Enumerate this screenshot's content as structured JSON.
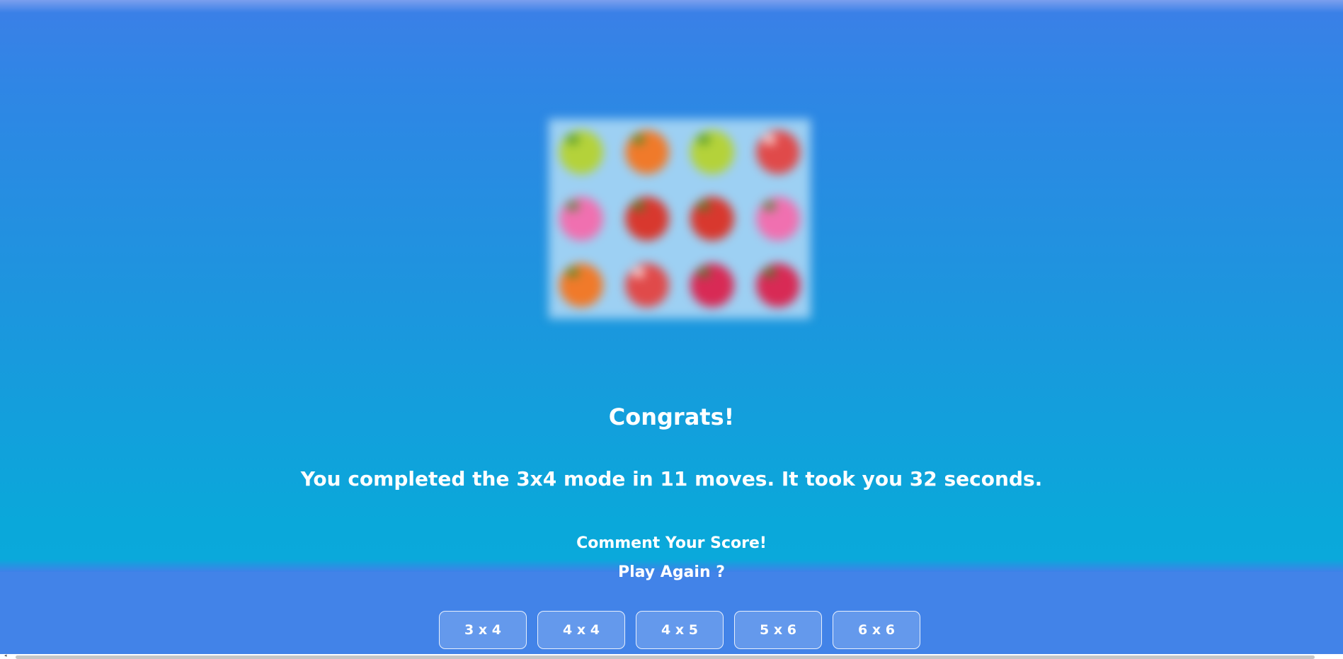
{
  "board": {
    "rows": 3,
    "cols": 4,
    "cards": [
      {
        "fruit": "pear",
        "color": "#b4d23a",
        "pale": false
      },
      {
        "fruit": "orange",
        "color": "#f07a2a",
        "pale": false
      },
      {
        "fruit": "pear",
        "color": "#b4d23a",
        "pale": false
      },
      {
        "fruit": "lychee",
        "color": "#e04a4a",
        "pale": true
      },
      {
        "fruit": "dragonfruit",
        "color": "#f070b0",
        "pale": false
      },
      {
        "fruit": "strawberry",
        "color": "#d8382e",
        "pale": false
      },
      {
        "fruit": "strawberry",
        "color": "#d8382e",
        "pale": false
      },
      {
        "fruit": "dragonfruit",
        "color": "#f070b0",
        "pale": false
      },
      {
        "fruit": "orange",
        "color": "#f07a2a",
        "pale": false
      },
      {
        "fruit": "lychee",
        "color": "#e04a4a",
        "pale": true
      },
      {
        "fruit": "cherry",
        "color": "#d82a55",
        "pale": false
      },
      {
        "fruit": "cherry",
        "color": "#d82a55",
        "pale": false
      }
    ]
  },
  "end_screen": {
    "congrats": "Congrats!",
    "result": "You completed the 3x4 mode in 11 moves. It took you 32 seconds.",
    "comment": "Comment Your Score!",
    "play_again": "Play Again ?"
  },
  "modes": [
    {
      "label": "3 x 4",
      "id": "3x4"
    },
    {
      "label": "4 x 4",
      "id": "4x4"
    },
    {
      "label": "4 x 5",
      "id": "4x5"
    },
    {
      "label": "5 x 6",
      "id": "5x6"
    },
    {
      "label": "6 x 6",
      "id": "6x6"
    }
  ],
  "colors": {
    "background": "#2f8ae4",
    "bottom_bar": "#4283e8",
    "text": "#ffffff"
  }
}
